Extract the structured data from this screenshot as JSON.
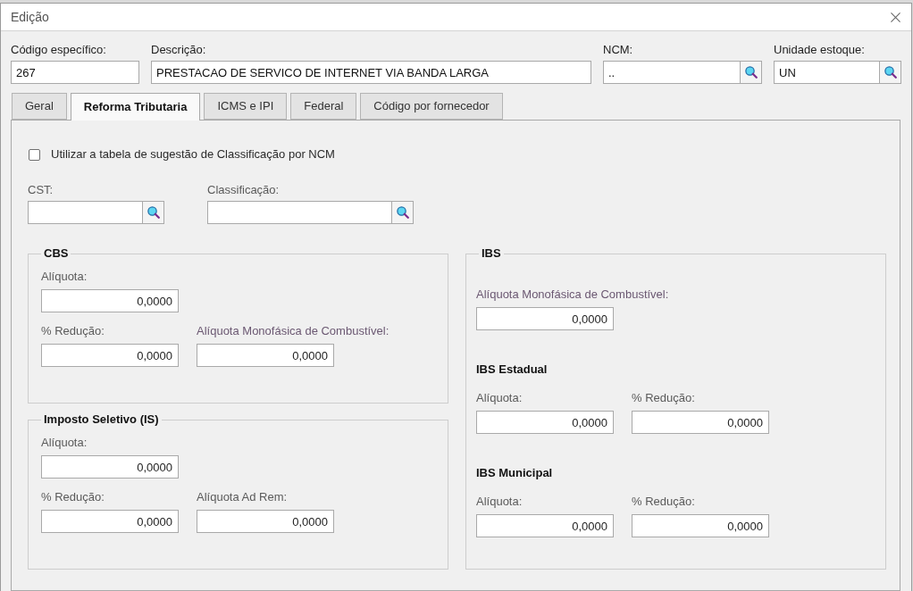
{
  "window": {
    "title": "Edição"
  },
  "header_fields": [
    {
      "label": "Código específico:",
      "value": "267",
      "kind": "text"
    },
    {
      "label": "Descrição:",
      "value": "PRESTACAO DE SERVICO DE INTERNET VIA BANDA LARGA",
      "kind": "text"
    },
    {
      "label": "NCM:",
      "value": "..",
      "kind": "lookup"
    },
    {
      "label": "Unidade estoque:",
      "value": "UN",
      "kind": "lookup"
    }
  ],
  "tabs": [
    {
      "label": "Geral",
      "selected": false
    },
    {
      "label": "Reforma Tributaria",
      "selected": true
    },
    {
      "label": "ICMS e IPI",
      "selected": false
    },
    {
      "label": "Federal",
      "selected": false
    },
    {
      "label": "Código por fornecedor",
      "selected": false
    }
  ],
  "panel": {
    "checkbox": {
      "label": "Utilizar a tabela de sugestão de Classificação por NCM",
      "checked": false
    },
    "lookup_fields": [
      {
        "label": "CST:",
        "kind": "lookup"
      },
      {
        "label": "Classificação:",
        "kind": "lookup"
      }
    ],
    "columns": [
      {
        "groups": [
          {
            "title": "CBS",
            "sections": [
              {
                "rows": [
                  {
                    "fields": [
                      {
                        "label": "Alíquota:",
                        "value": "0,0000",
                        "color": "#5a5a5a"
                      }
                    ]
                  },
                  {
                    "fields": [
                      {
                        "label": "% Redução:",
                        "value": "0,0000",
                        "color": "#5a5a5a"
                      },
                      {
                        "label": "Alíquota Monofásica de Combustível:",
                        "value": "0,0000",
                        "color": "#6b5872"
                      }
                    ]
                  }
                ]
              }
            ]
          },
          {
            "title": "Imposto Seletivo (IS)",
            "sections": [
              {
                "rows": [
                  {
                    "fields": [
                      {
                        "label": "Alíquota:",
                        "value": "0,0000",
                        "color": "#5a5a5a"
                      }
                    ]
                  },
                  {
                    "fields": [
                      {
                        "label": "% Redução:",
                        "value": "0,0000",
                        "color": "#5a5a5a"
                      },
                      {
                        "label": "Alíquota Ad Rem:",
                        "value": "0,0000",
                        "color": "#5a5a5a"
                      }
                    ]
                  }
                ]
              }
            ]
          }
        ]
      },
      {
        "groups": [
          {
            "title": "IBS",
            "sections": [
              {
                "rows": [
                  {
                    "fields": [
                      {
                        "label": "Alíquota Monofásica de Combustível:",
                        "value": "0,0000",
                        "color": "#6b5872"
                      }
                    ]
                  }
                ]
              },
              {
                "title": "IBS Estadual",
                "rows": [
                  {
                    "fields": [
                      {
                        "label": "Alíquota:",
                        "value": "0,0000",
                        "color": "#5a5a5a"
                      },
                      {
                        "label": "% Redução:",
                        "value": "0,0000",
                        "color": "#5a5a5a"
                      }
                    ]
                  }
                ]
              },
              {
                "title": "IBS Municipal",
                "rows": [
                  {
                    "fields": [
                      {
                        "label": "Alíquota:",
                        "value": "0,0000",
                        "color": "#5a5a5a"
                      },
                      {
                        "label": "% Redução:",
                        "value": "0,0000",
                        "color": "#5a5a5a"
                      }
                    ]
                  }
                ]
              }
            ]
          }
        ]
      }
    ]
  }
}
